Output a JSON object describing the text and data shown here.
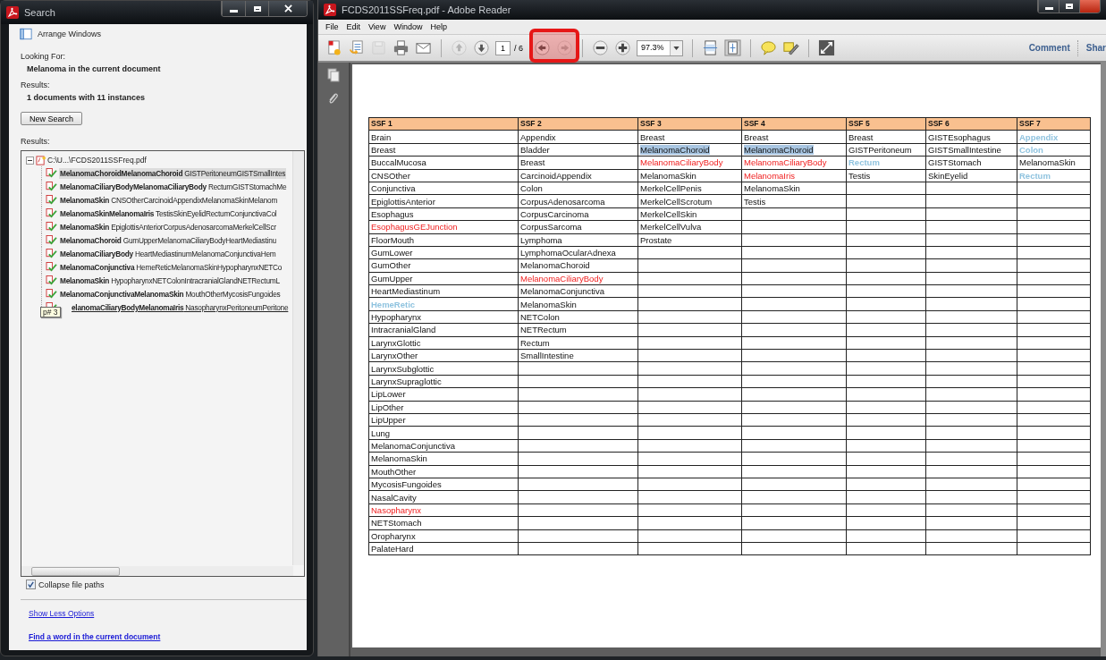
{
  "search_window": {
    "title": "Search",
    "arrange_windows": "Arrange Windows",
    "looking_for_label": "Looking For:",
    "looking_for": "Melanoma in the current document",
    "results_label": "Results:",
    "results_summary": "1 documents with 11 instances",
    "new_search_button": "New Search",
    "results_list_label": "Results:",
    "results_tree": {
      "label": "C:\\U...\\FCDS2011SSFreq.pdf",
      "expanded": true,
      "children": [
        {
          "match": "MelanomaChoroidMelanomaChoroid",
          "context": "GISTPeritoneumGISTSmallIntes",
          "selected": true,
          "hovered": false
        },
        {
          "match": "MelanomaCiliaryBodyMelanomaCiliaryBody",
          "context": "RectumGISTStomachMe",
          "selected": false,
          "hovered": false
        },
        {
          "match": "MelanomaSkin",
          "context": "CNSOtherCarcinoidAppendixMelanomaSkinMelanom",
          "selected": false,
          "hovered": false
        },
        {
          "match": "MelanomaSkinMelanomaIris",
          "context": "TestisSkinEyelidRectumConjunctivaCol",
          "selected": false,
          "hovered": false
        },
        {
          "match": "MelanomaSkin",
          "context": "EpiglottisAnteriorCorpusAdenosarcomaMerkelCellScr",
          "selected": false,
          "hovered": false
        },
        {
          "match": "MelanomaChoroid",
          "context": "GumUpperMelanomaCiliaryBodyHeartMediastinu",
          "selected": false,
          "hovered": false
        },
        {
          "match": "MelanomaCiliaryBody",
          "context": "HeartMediastinumMelanomaConjunctivaHem",
          "selected": false,
          "hovered": false
        },
        {
          "match": "MelanomaConjunctiva",
          "context": "HemeReticMelanomaSkinHypopharynxNETCo",
          "selected": false,
          "hovered": false
        },
        {
          "match": "MelanomaSkin",
          "context": "HypopharynxNETColonIntracranialGlandNETRectumL",
          "selected": false,
          "hovered": false
        },
        {
          "match": "MelanomaConjunctivaMelanomaSkin",
          "context": "MouthOtherMycosisFungoides",
          "selected": false,
          "hovered": false
        },
        {
          "match": "elanomaCiliaryBodyMelanomaIris",
          "context": "NasopharynxPeritoneumPeritone",
          "selected": false,
          "hovered": true,
          "tooltip": "p# 3"
        }
      ]
    },
    "collapse_file_paths": {
      "label": "Collapse file paths",
      "checked": true
    },
    "links": [
      "Show Less Options",
      "Find a word in the current document"
    ]
  },
  "reader_window": {
    "title": "FCDS2011SSFreq.pdf - Adobe Reader",
    "menu": [
      "File",
      "Edit",
      "View",
      "Window",
      "Help"
    ],
    "toolbar": [
      {
        "kind": "create",
        "disabled": false
      },
      {
        "kind": "open",
        "disabled": false
      },
      {
        "kind": "save",
        "disabled": true
      },
      {
        "kind": "print",
        "disabled": false
      },
      {
        "kind": "email",
        "disabled": false
      },
      {
        "kind": "sep"
      },
      {
        "kind": "page_up",
        "disabled": true
      },
      {
        "kind": "page_down",
        "disabled": false
      },
      {
        "kind": "page",
        "value": "1",
        "total": "/ 6"
      },
      {
        "kind": "view_back",
        "disabled": false
      },
      {
        "kind": "view_forward",
        "disabled": true
      },
      {
        "kind": "sep"
      },
      {
        "kind": "zoom_out",
        "disabled": false
      },
      {
        "kind": "zoom_in",
        "disabled": false
      },
      {
        "kind": "zoom",
        "value": "97.3%"
      },
      {
        "kind": "sep"
      },
      {
        "kind": "fit_width",
        "disabled": false
      },
      {
        "kind": "fit_page",
        "disabled": false
      },
      {
        "kind": "sep"
      },
      {
        "kind": "comment",
        "disabled": false
      },
      {
        "kind": "sign",
        "disabled": false
      },
      {
        "kind": "sep"
      },
      {
        "kind": "fullscreen",
        "disabled": false
      }
    ],
    "toolbar_links": [
      "Comment",
      "Shar"
    ],
    "table": {
      "columns": [
        {
          "header": "SSF 1",
          "cells": [
            "Brain",
            "Breast",
            "BuccalMucosa",
            "CNSOther",
            "Conjunctiva",
            "EpiglottisAnterior",
            "Esophagus",
            {
              "text": "EsophagusGEJunction",
              "kind": "red"
            },
            "FloorMouth",
            "GumLower",
            "GumOther",
            "GumUpper",
            "HeartMediastinum",
            {
              "text": "HemeRetic",
              "kind": "faded"
            },
            "Hypopharynx",
            "IntracranialGland",
            "LarynxGlottic",
            "LarynxOther",
            "LarynxSubglottic",
            "LarynxSupraglottic",
            "LipLower",
            "LipOther",
            "LipUpper",
            "Lung",
            "MelanomaConjunctiva",
            "MelanomaSkin",
            "MouthOther",
            "MycosisFungoides",
            "NasalCavity",
            {
              "text": "Nasopharynx",
              "kind": "red"
            },
            "NETStomach",
            "Oropharynx",
            "PalateHard"
          ]
        },
        {
          "header": "SSF 2",
          "cells": [
            "Appendix",
            "Bladder",
            "Breast",
            "CarcinoidAppendix",
            "Colon",
            "CorpusAdenosarcoma",
            "CorpusCarcinoma",
            "CorpusSarcoma",
            "Lymphoma",
            "LymphomaOcularAdnexa",
            "MelanomaChoroid",
            {
              "text": "MelanomaCiliaryBody",
              "kind": "red"
            },
            "MelanomaConjunctiva",
            "MelanomaSkin",
            "NETColon",
            "NETRectum",
            "Rectum",
            "SmallIntestine"
          ]
        },
        {
          "header": "SSF 3",
          "cells": [
            "Breast",
            {
              "text": "MelanomaChoroid",
              "kind": "highlight"
            },
            {
              "text": "MelanomaCiliaryBody",
              "kind": "red"
            },
            "MelanomaSkin",
            "MerkelCellPenis",
            "MerkelCellScrotum",
            "MerkelCellSkin",
            "MerkelCellVulva",
            "Prostate"
          ]
        },
        {
          "header": "SSF 4",
          "cells": [
            "Breast",
            {
              "text": "MelanomaChoroid",
              "kind": "highlight"
            },
            {
              "text": "MelanomaCiliaryBody",
              "kind": "red"
            },
            {
              "text": "MelanomaIris",
              "kind": "red"
            },
            "MelanomaSkin",
            "Testis"
          ]
        },
        {
          "header": "SSF 5",
          "cells": [
            "Breast",
            "GISTPeritoneum",
            {
              "text": "Rectum",
              "kind": "faded"
            },
            "Testis"
          ]
        },
        {
          "header": "SSF 6",
          "cells": [
            "GISTEsophagus",
            "GISTSmallIntestine",
            "GISTStomach",
            "SkinEyelid"
          ]
        },
        {
          "header": "SSF 7",
          "cells": [
            {
              "text": "Appendix",
              "kind": "faded"
            },
            {
              "text": "Colon",
              "kind": "faded"
            },
            "MelanomaSkin",
            {
              "text": "Rectum",
              "kind": "faded"
            }
          ]
        }
      ]
    }
  }
}
